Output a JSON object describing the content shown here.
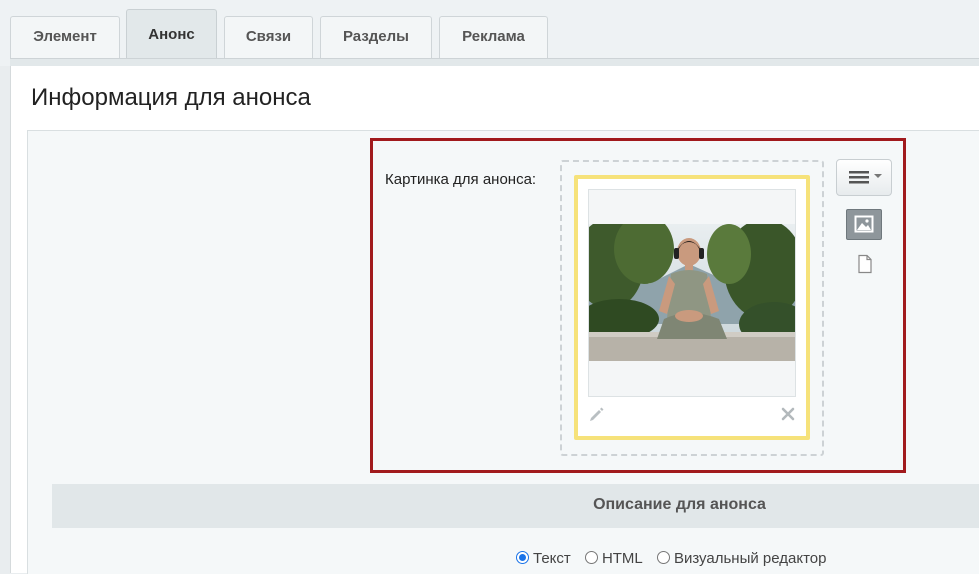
{
  "tabs": [
    {
      "label": "Элемент",
      "active": false
    },
    {
      "label": "Анонс",
      "active": true
    },
    {
      "label": "Связи",
      "active": false
    },
    {
      "label": "Разделы",
      "active": false
    },
    {
      "label": "Реклама",
      "active": false
    }
  ],
  "page": {
    "title": "Информация для анонса"
  },
  "preview_image": {
    "label": "Картинка для анонса:",
    "icons": {
      "menu": "menu-icon",
      "image_mode": "image-icon",
      "file_mode": "file-icon",
      "edit": "pencil-icon",
      "remove": "close-icon"
    },
    "frame_color": "#f6e27a",
    "highlight_color": "#a11a1d"
  },
  "description": {
    "heading": "Описание для анонса",
    "options": [
      {
        "label": "Текст",
        "checked": true
      },
      {
        "label": "HTML",
        "checked": false
      },
      {
        "label": "Визуальный редактор",
        "checked": false
      }
    ]
  }
}
